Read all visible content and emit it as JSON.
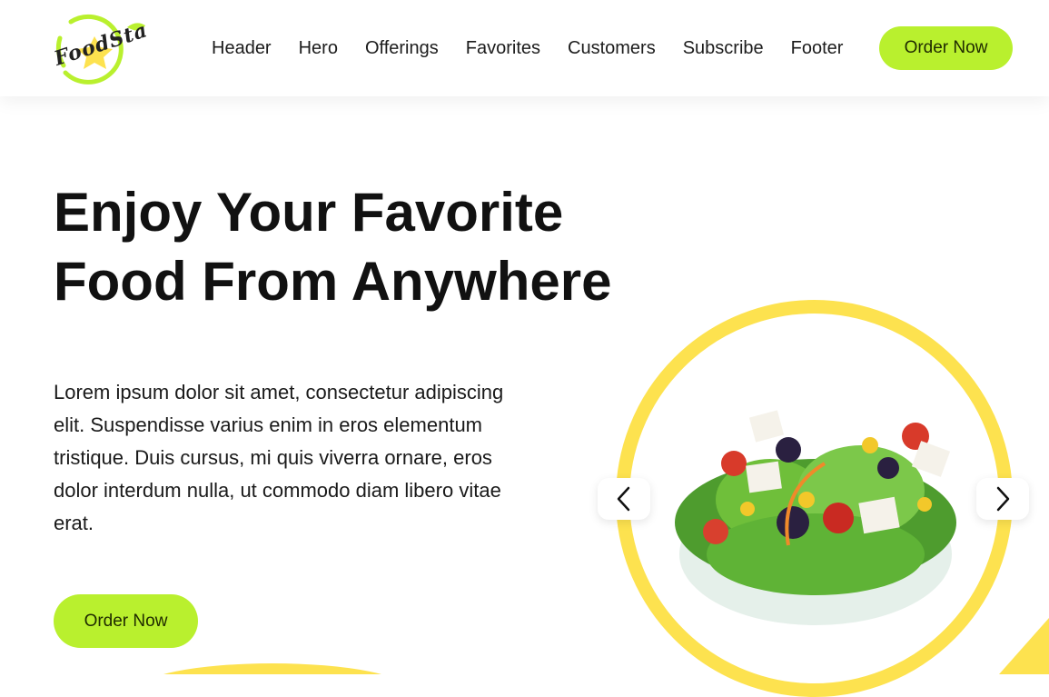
{
  "header": {
    "logo_text": "FoodSta",
    "nav": [
      "Header",
      "Hero",
      "Offerings",
      "Favorites",
      "Customers",
      "Subscribe",
      "Footer"
    ],
    "order_button": "Order Now"
  },
  "hero": {
    "title_line1": "Enjoy Your Favorite",
    "title_line2": "Food From Anywhere",
    "description": "Lorem ipsum dolor sit amet, consectetur adipiscing elit. Suspendisse varius enim in eros elementum tristique. Duis cursus, mi quis viverra ornare, eros dolor interdum nulla, ut commodo diam libero vitae erat.",
    "order_button": "Order Now",
    "carousel": {
      "prev_icon": "chevron-left-icon",
      "next_icon": "chevron-right-icon",
      "image": "salad-bowl"
    }
  },
  "colors": {
    "accent": "#b9f02e",
    "ring": "#fde24f",
    "text": "#111111"
  }
}
